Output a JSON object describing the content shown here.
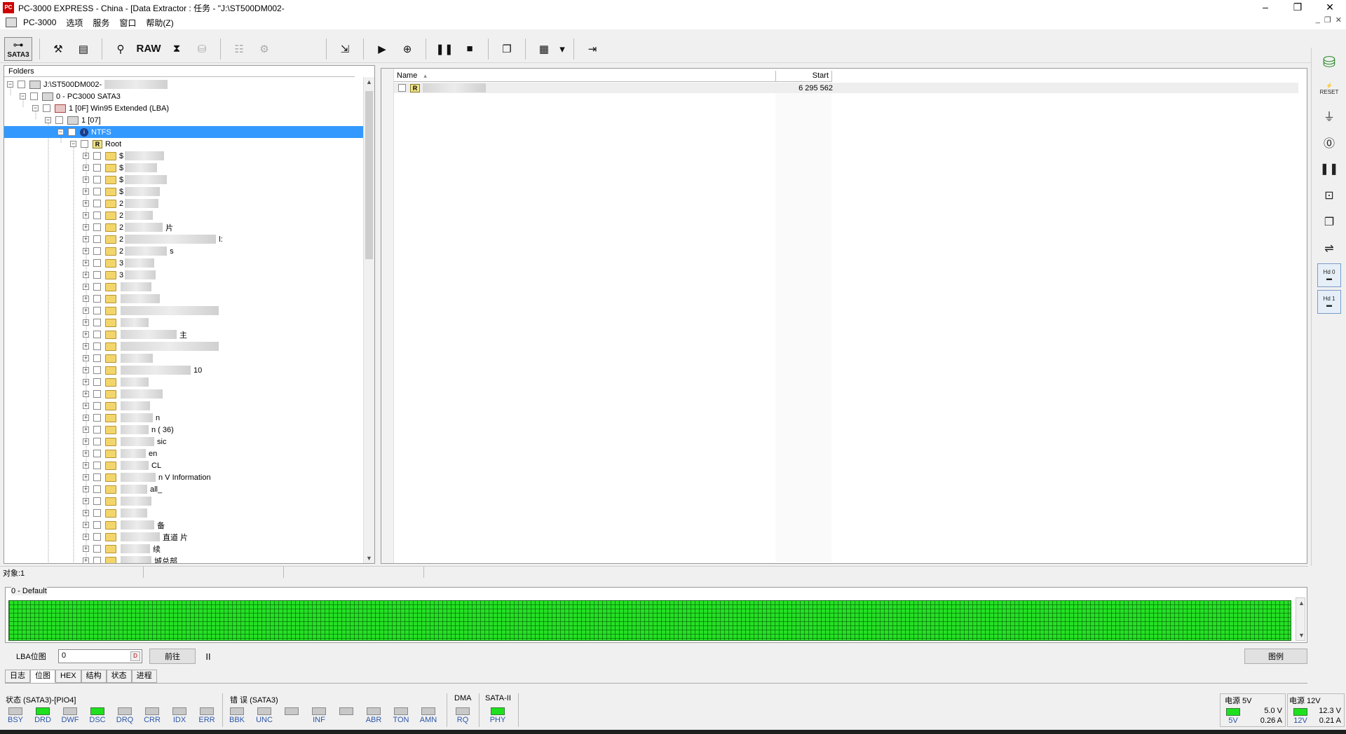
{
  "window": {
    "title": "PC-3000 EXPRESS - China - [Data Extractor : 任务 - \"J:\\ST500DM002-",
    "controls": [
      "–",
      "❐",
      "✕"
    ]
  },
  "menu": {
    "items": [
      "PC-3000",
      "选项",
      "服务",
      "窗口",
      "帮助(Z)"
    ],
    "mdi_controls": [
      "_",
      "❐",
      "✕"
    ]
  },
  "toolbar": {
    "sata_label": "SATA3",
    "raw_label": "RAW"
  },
  "folders": {
    "header": "Folders",
    "tree": [
      {
        "label": "J:\\ST500DM002-",
        "icon": "project-icon",
        "expanded": true
      },
      {
        "label": "0 - PC3000 SATA3",
        "icon": "disk-icon",
        "expanded": true
      },
      {
        "label": "1 [0F] Win95 Extended  (LBA)",
        "icon": "partition-icon",
        "expanded": true
      },
      {
        "label": "1 [07]",
        "icon": "disk-icon",
        "expanded": true
      },
      {
        "label": "NTFS",
        "icon": "ntfs-icon",
        "expanded": true,
        "selected": true
      },
      {
        "label": "Root",
        "icon": "root-icon",
        "expanded": true
      }
    ],
    "subfolders": [
      "$",
      "$",
      "$",
      "$",
      "2",
      "2",
      "2",
      "2",
      "2",
      "3",
      "3",
      "",
      "",
      "",
      "",
      "",
      "",
      "",
      "",
      "",
      "",
      "",
      "",
      "",
      "",
      "",
      "",
      "",
      "",
      "",
      "",
      "",
      "",
      "",
      "",
      "",
      "",
      "",
      "",
      "",
      "",
      "",
      "",
      "",
      "",
      "",
      "",
      "",
      "",
      "",
      ""
    ],
    "visible_fragments": [
      {
        "row": 6,
        "text": "片"
      },
      {
        "row": 7,
        "text": "l:"
      },
      {
        "row": 8,
        "text": "s"
      },
      {
        "row": 15,
        "text": "主"
      },
      {
        "row": 18,
        "text": "10"
      },
      {
        "row": 22,
        "text": "n"
      },
      {
        "row": 23,
        "text": "n (        36)"
      },
      {
        "row": 24,
        "text": "sic"
      },
      {
        "row": 25,
        "text": "en"
      },
      {
        "row": 26,
        "text": "CL"
      },
      {
        "row": 27,
        "text": "n V        Information"
      },
      {
        "row": 28,
        "text": "all_"
      },
      {
        "row": 31,
        "text": "备"
      },
      {
        "row": 32,
        "text": "直道        片"
      },
      {
        "row": 33,
        "text": "续"
      },
      {
        "row": 34,
        "text": "        城总部"
      }
    ]
  },
  "files": {
    "columns": [
      "Name",
      "Start"
    ],
    "rows": [
      {
        "name": "",
        "start": "6 295 562"
      }
    ]
  },
  "status": {
    "objects": "对象:1"
  },
  "bitmap": {
    "label": "0 - Default",
    "lba_label": "LBA位图",
    "lba_value": "0",
    "spin_label": "D",
    "goto_label": "前往",
    "pause_label": "II",
    "legend_label": "图例"
  },
  "tabs": [
    "日志",
    "位图",
    "HEX",
    "结构",
    "状态",
    "进程"
  ],
  "indicators": {
    "status_group": "状态 (SATA3)-[PIO4]",
    "status_leds": [
      {
        "name": "BSY",
        "on": false
      },
      {
        "name": "DRD",
        "on": true
      },
      {
        "name": "DWF",
        "on": false
      },
      {
        "name": "DSC",
        "on": true
      },
      {
        "name": "DRQ",
        "on": false
      },
      {
        "name": "CRR",
        "on": false
      },
      {
        "name": "IDX",
        "on": false
      },
      {
        "name": "ERR",
        "on": false
      }
    ],
    "error_group": "错 误 (SATA3)",
    "error_leds": [
      "BBK",
      "UNC",
      "",
      "INF",
      "",
      "ABR",
      "TON",
      "AMN"
    ],
    "dma_group": "DMA",
    "dma_leds": [
      "RQ"
    ],
    "sata_group": "SATA-II",
    "sata_leds": [
      "PHY"
    ],
    "power5": {
      "title": "电源 5V",
      "led": "5V",
      "voltage": "5.0 V",
      "current": "0.26 A"
    },
    "power12": {
      "title": "电源 12V",
      "led": "12V",
      "voltage": "12.3 V",
      "current": "0.21 A"
    }
  },
  "colors": {
    "led_on": "#1ee01e",
    "selection": "#3399ff",
    "bitmap_green": "#25e025"
  }
}
